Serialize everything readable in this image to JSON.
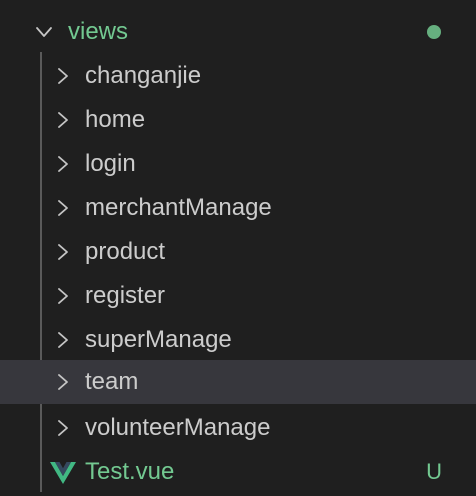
{
  "explorer": {
    "root_folder": {
      "label": "views",
      "icon": "chevron-down-icon",
      "status": "modified-dot",
      "status_color": "#73c991"
    },
    "items": [
      {
        "label": "changanjie",
        "type": "folder",
        "icon": "chevron-right-icon"
      },
      {
        "label": "home",
        "type": "folder",
        "icon": "chevron-right-icon"
      },
      {
        "label": "login",
        "type": "folder",
        "icon": "chevron-right-icon"
      },
      {
        "label": "merchantManage",
        "type": "folder",
        "icon": "chevron-right-icon"
      },
      {
        "label": "product",
        "type": "folder",
        "icon": "chevron-right-icon"
      },
      {
        "label": "register",
        "type": "folder",
        "icon": "chevron-right-icon"
      },
      {
        "label": "superManage",
        "type": "folder",
        "icon": "chevron-right-icon"
      },
      {
        "label": "team",
        "type": "folder",
        "icon": "chevron-right-icon",
        "selected": true
      },
      {
        "label": "volunteerManage",
        "type": "folder",
        "icon": "chevron-right-icon"
      }
    ],
    "file": {
      "label": "Test.vue",
      "icon": "vue-file-icon",
      "status": "U",
      "color": "#73c991"
    }
  },
  "colors": {
    "background": "#1f1f1f",
    "selected_row": "#37373d",
    "text": "#cccccc",
    "git_untracked": "#73c991"
  }
}
